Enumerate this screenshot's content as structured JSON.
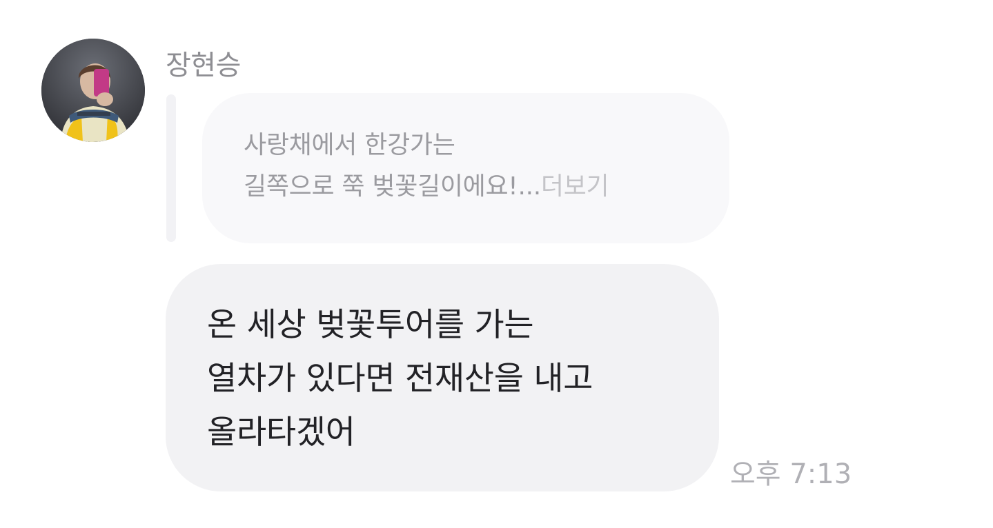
{
  "message": {
    "sender_name": "장현승",
    "avatar_icon": "profile-photo-icon",
    "reply_quote": {
      "line1": "사랑채에서 한강가는",
      "line2": "길쪽으로 쭉 벚꽃길이에요!...",
      "more_label": "더보기"
    },
    "body_lines": [
      "온 세상 벚꽃투어를 가는",
      "열차가 있다면 전재산을 내고",
      "올라타겠어"
    ],
    "timestamp": "오후 7:13"
  },
  "colors": {
    "background": "#ffffff",
    "bubble": "#f2f2f4",
    "quote_bubble": "#f8f8fa",
    "name_text": "#8e8e93",
    "body_text": "#222226",
    "timestamp_text": "#b0b0b5"
  }
}
